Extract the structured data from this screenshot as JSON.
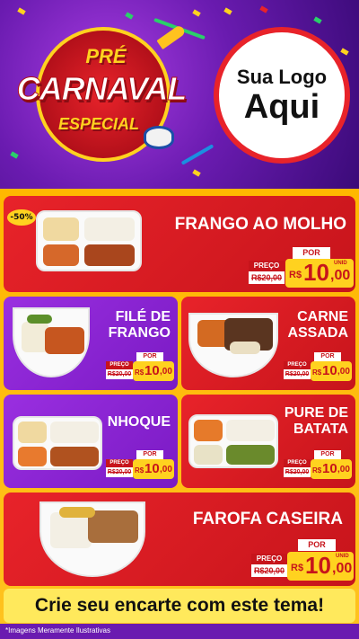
{
  "header": {
    "badge": {
      "pre": "PRÉ",
      "carnaval": "CARNAVAL",
      "especial": "ESPECIAL"
    },
    "logo": {
      "line1": "Sua Logo",
      "line2": "Aqui"
    }
  },
  "labels": {
    "preco": "PREÇO",
    "por": "POR",
    "currency": "R$",
    "unid": "UNID"
  },
  "items": [
    {
      "name": "FRANGO AO MOLHO",
      "discount": "-50%",
      "old_price": "R$20,00",
      "price_int": "10",
      "price_dec": ",00",
      "icon": "food-tray-icon"
    },
    {
      "name_l1": "FILÉ DE",
      "name_l2": "FRANGO",
      "old_price": "R$20,00",
      "price_int": "10",
      "price_dec": ",00",
      "icon": "food-bowl-icon"
    },
    {
      "name_l1": "CARNE",
      "name_l2": "ASSADA",
      "old_price": "R$20,00",
      "price_int": "10",
      "price_dec": ",00",
      "icon": "food-bowl-icon"
    },
    {
      "name": "NHOQUE",
      "old_price": "R$20,00",
      "price_int": "10",
      "price_dec": ",00",
      "icon": "food-tray-icon"
    },
    {
      "name_l1": "PURE DE",
      "name_l2": "BATATA",
      "old_price": "R$20,00",
      "price_int": "10",
      "price_dec": ",00",
      "icon": "food-tray-icon"
    },
    {
      "name": "FAROFA CASEIRA",
      "old_price": "R$20,00",
      "price_int": "10",
      "price_dec": ",00",
      "icon": "food-bowl-icon"
    }
  ],
  "cta": "Crie seu encarte com este tema!",
  "disclaimer": "*Imagens Meramente Ilustrativas",
  "colors": {
    "red": "#e8232a",
    "purple": "#8a24d4",
    "yellow": "#ffc21f",
    "price_yellow": "#ffd21f"
  }
}
